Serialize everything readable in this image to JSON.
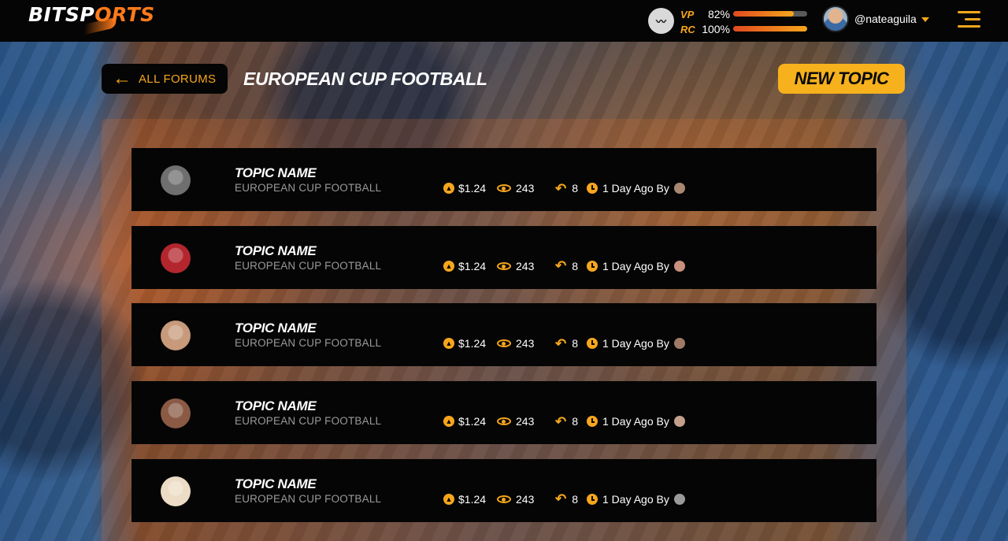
{
  "header": {
    "logo_part1": "BITSP",
    "logo_part2": "ORTS",
    "steem_icon": "steem-icon",
    "vp_label": "VP",
    "vp_value": "82%",
    "vp_fraction": 0.82,
    "rc_label": "RC",
    "rc_value": "100%",
    "rc_fraction": 1.0,
    "username": "@nateaguila",
    "accent": "#f6a61c"
  },
  "page": {
    "back_label": "ALL FORUMS",
    "title": "EUROPEAN CUP FOOTBALL",
    "new_topic_label": "NEW TOPIC"
  },
  "topics": [
    {
      "name": "TOPIC NAME",
      "forum": "EUROPEAN CUP FOOTBALL",
      "value": "$1.24",
      "views": "243",
      "replies": "8",
      "time": "1 Day Ago By",
      "avatar_color": "#6f6f6f",
      "mini_color": "#a88670"
    },
    {
      "name": "TOPIC NAME",
      "forum": "EUROPEAN CUP FOOTBALL",
      "value": "$1.24",
      "views": "243",
      "replies": "8",
      "time": "1 Day Ago By",
      "avatar_color": "#b3262e",
      "mini_color": "#c9907e"
    },
    {
      "name": "TOPIC NAME",
      "forum": "EUROPEAN CUP FOOTBALL",
      "value": "$1.24",
      "views": "243",
      "replies": "8",
      "time": "1 Day Ago By",
      "avatar_color": "#c79a7b",
      "mini_color": "#9f7a66"
    },
    {
      "name": "TOPIC NAME",
      "forum": "EUROPEAN CUP FOOTBALL",
      "value": "$1.24",
      "views": "243",
      "replies": "8",
      "time": "1 Day Ago By",
      "avatar_color": "#8a5a45",
      "mini_color": "#c4a08c"
    },
    {
      "name": "TOPIC NAME",
      "forum": "EUROPEAN CUP FOOTBALL",
      "value": "$1.24",
      "views": "243",
      "replies": "8",
      "time": "1 Day Ago By",
      "avatar_color": "#ecdcc6",
      "mini_color": "#9a9a9a"
    }
  ]
}
